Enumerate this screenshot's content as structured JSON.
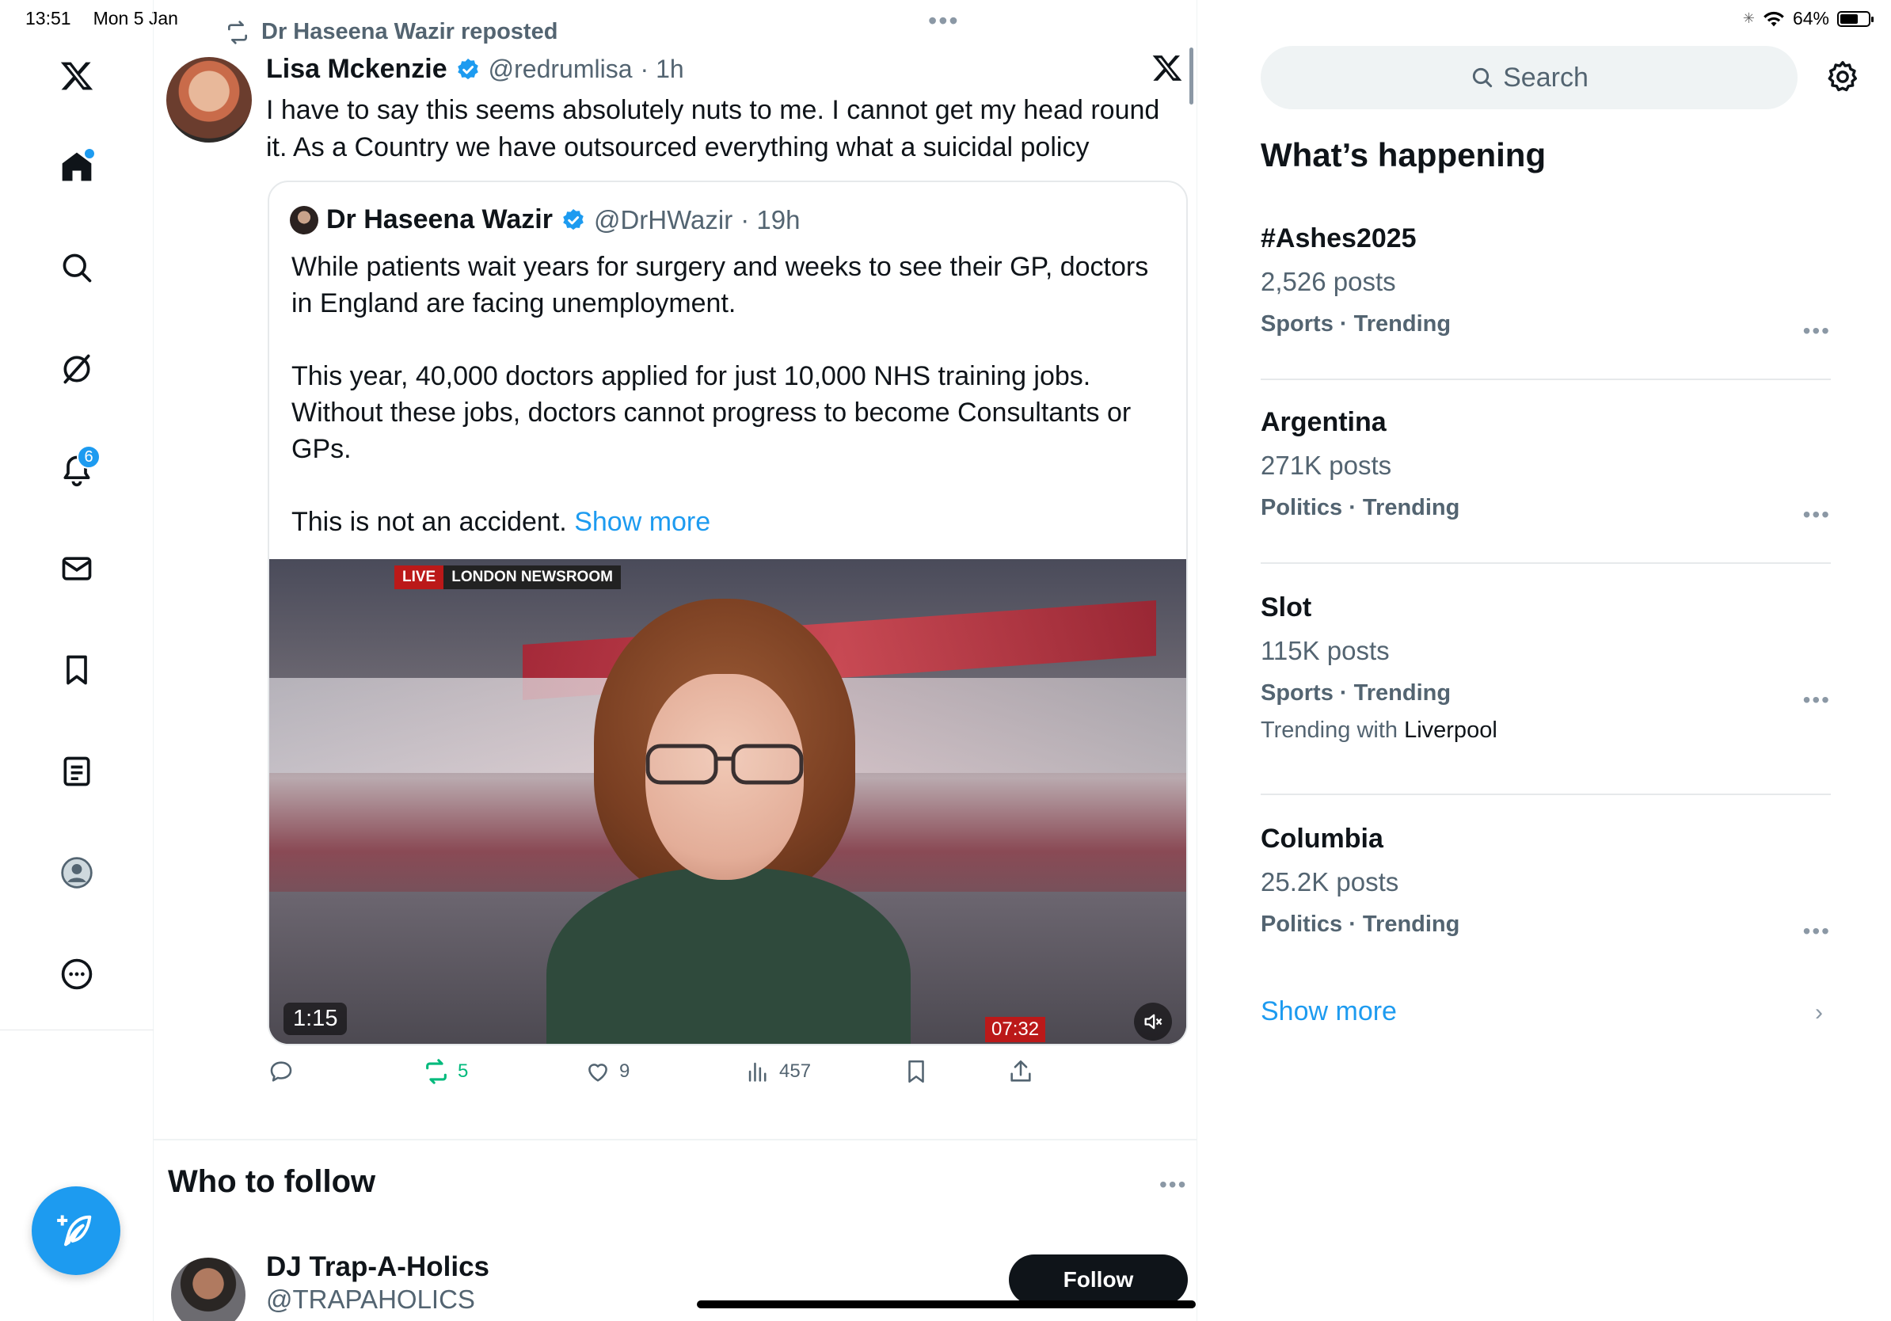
{
  "status_bar": {
    "time": "13:51",
    "date": "Mon 5 Jan",
    "battery": "64%",
    "battery_level": 0.64
  },
  "nav": {
    "notifications_badge": "6"
  },
  "tweet": {
    "repost_by": "Dr Haseena Wazir reposted",
    "author_name": "Lisa Mckenzie",
    "author_handle": "@redrumlisa",
    "age": "· 1h",
    "text": "I have to say this seems absolutely nuts to me. I cannot get my head round it. As a Country we have outsourced everything what a suicidal policy",
    "quote": {
      "author_name": "Dr Haseena Wazir",
      "author_handle": "@DrHWazir",
      "age": "· 19h",
      "para1": "While patients wait years for surgery and weeks to see their GP, doctors in England are facing unemployment.",
      "para2": "This year, 40,000 doctors applied for just 10,000 NHS training jobs. Without these jobs, doctors cannot progress to become Consultants or GPs.",
      "para3": "This is not an accident.",
      "show_more": "Show more",
      "video": {
        "live_label": "LIVE",
        "channel_label": "LONDON NEWSROOM",
        "duration": "1:15",
        "clock": "07:32"
      }
    },
    "actions": {
      "retweets": "5",
      "likes": "9",
      "views": "457"
    }
  },
  "who_to_follow": {
    "title": "Who to follow",
    "user_name": "DJ Trap-A-Holics",
    "user_handle": "@TRAPAHOLICS",
    "follow_label": "Follow"
  },
  "sidebar": {
    "search_placeholder": "Search",
    "whats_happening": "What’s happening",
    "trends": [
      {
        "title": "#Ashes2025",
        "count": "2,526 posts",
        "meta": "Sports · Trending"
      },
      {
        "title": "Argentina",
        "count": "271K posts",
        "meta": "Politics · Trending"
      },
      {
        "title": "Slot",
        "count": "115K posts",
        "meta": "Sports · Trending",
        "with_prefix": "Trending with",
        "with_name": "Liverpool"
      },
      {
        "title": "Columbia",
        "count": "25.2K posts",
        "meta": "Politics · Trending"
      }
    ],
    "show_more": "Show more"
  },
  "colors": {
    "accent": "#1d9bf0",
    "retweet_green": "#00ba7c",
    "text_secondary": "#536471"
  },
  "icons": [
    "x-logo-icon",
    "home-icon",
    "search-icon",
    "grok-icon",
    "bell-icon",
    "mail-icon",
    "bookmark-icon",
    "lists-icon",
    "profile-icon",
    "more-icon",
    "compose-icon",
    "verified-icon",
    "repost-icon",
    "reply-icon",
    "like-icon",
    "views-icon",
    "share-icon",
    "gear-icon",
    "mute-icon",
    "chevron-right-icon"
  ]
}
